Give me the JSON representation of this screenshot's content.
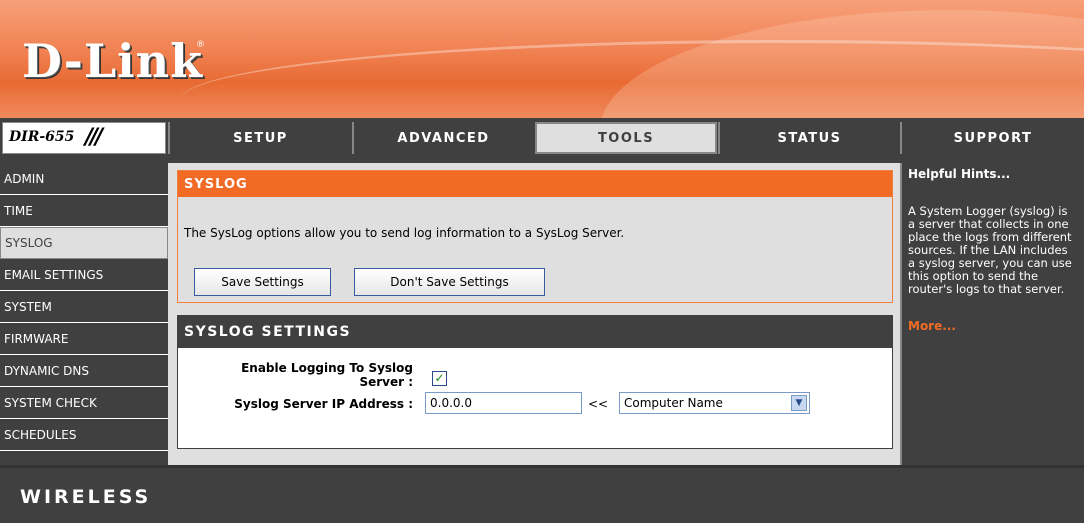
{
  "brand": {
    "logo": "D-Link",
    "model": "DIR-655",
    "model_slashes": "///"
  },
  "top_nav": [
    {
      "label": "SETUP",
      "active": false
    },
    {
      "label": "ADVANCED",
      "active": false
    },
    {
      "label": "TOOLS",
      "active": true
    },
    {
      "label": "STATUS",
      "active": false
    },
    {
      "label": "SUPPORT",
      "active": false
    }
  ],
  "sidebar": [
    {
      "label": "ADMIN",
      "active": false
    },
    {
      "label": "TIME",
      "active": false
    },
    {
      "label": "SYSLOG",
      "active": true
    },
    {
      "label": "EMAIL SETTINGS",
      "active": false
    },
    {
      "label": "SYSTEM",
      "active": false
    },
    {
      "label": "FIRMWARE",
      "active": false
    },
    {
      "label": "DYNAMIC DNS",
      "active": false
    },
    {
      "label": "SYSTEM CHECK",
      "active": false
    },
    {
      "label": "SCHEDULES",
      "active": false
    }
  ],
  "syslog_section": {
    "title": "SYSLOG",
    "description": "The SysLog options allow you to send log information to a SysLog Server.",
    "save_button": "Save Settings",
    "dont_save_button": "Don't Save Settings"
  },
  "syslog_settings": {
    "title": "SYSLOG SETTINGS",
    "enable_label_line1": "Enable Logging To Syslog",
    "enable_label_line2": "Server :",
    "enable_checked": true,
    "ip_label": "Syslog Server IP Address :",
    "ip_value": "0.0.0.0",
    "copy_arrow": "<<",
    "computer_select": "Computer Name"
  },
  "hints": {
    "title": "Helpful Hints...",
    "body": "A System Logger (syslog) is a server that collects in one place the logs from different sources. If the LAN includes a syslog server, you can use this option to send the router's logs to that server.",
    "more": "More..."
  },
  "footer": {
    "label": "WIRELESS"
  },
  "colors": {
    "accent_orange": "#f26b25",
    "dark_gray": "#404040",
    "light_gray": "#dfdfdf"
  }
}
